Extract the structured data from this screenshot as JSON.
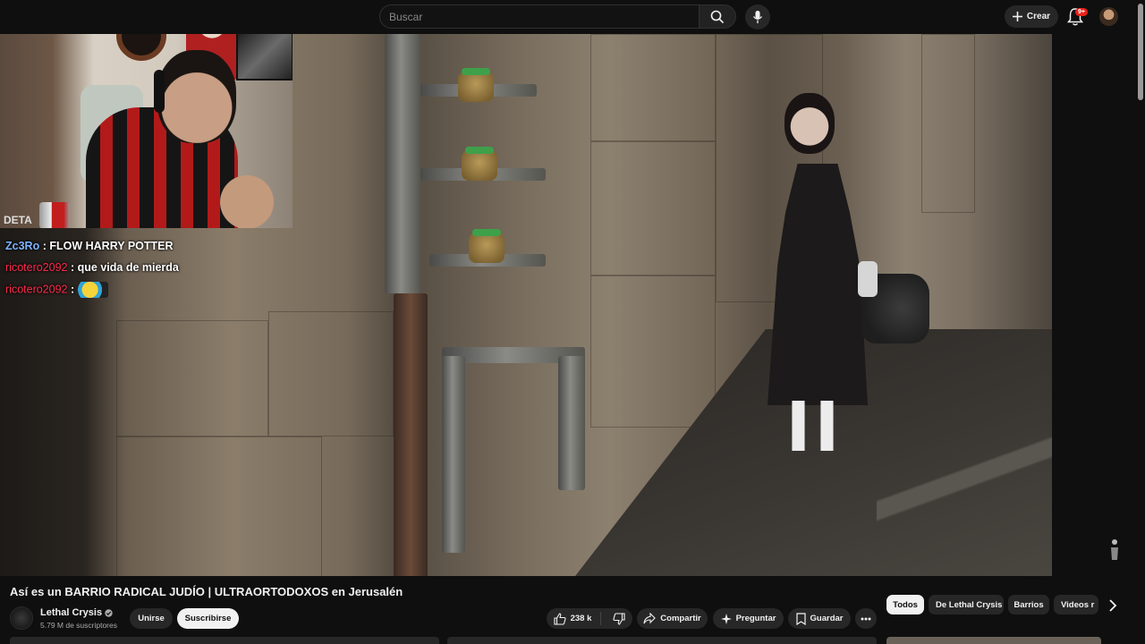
{
  "header": {
    "search_placeholder": "Buscar",
    "create_label": "Crear",
    "notifications_badge": "9+"
  },
  "stream_overlay": {
    "chat_cutoff": "DETA",
    "chat": [
      {
        "user": "Zc3Ro",
        "message": "FLOW HARRY POTTER"
      },
      {
        "user": "ricotero2092",
        "message": "que vida de mierda"
      },
      {
        "user": "ricotero2092",
        "message": ""
      }
    ],
    "separator": ":"
  },
  "video": {
    "title": "Así es un BARRIO RADICAL JUDÍO | ULTRAORTODOXOS en Jerusalén",
    "channel_name": "Lethal Crysis",
    "subscribers": "5.79 M de suscriptores",
    "join_label": "Unirse",
    "subscribe_label": "Suscribirse",
    "likes": "238 k",
    "share_label": "Compartir",
    "ask_label": "Preguntar",
    "save_label": "Guardar"
  },
  "chips": [
    "Todos",
    "De Lethal Crysis",
    "Barrios",
    "Videos r"
  ],
  "colors": {
    "background": "#0f0f0f",
    "chat_user_red": "#ff2b4d",
    "chat_user_blue": "#7fb2ff",
    "badge_red": "#e62117",
    "button_bg": "#272727"
  }
}
